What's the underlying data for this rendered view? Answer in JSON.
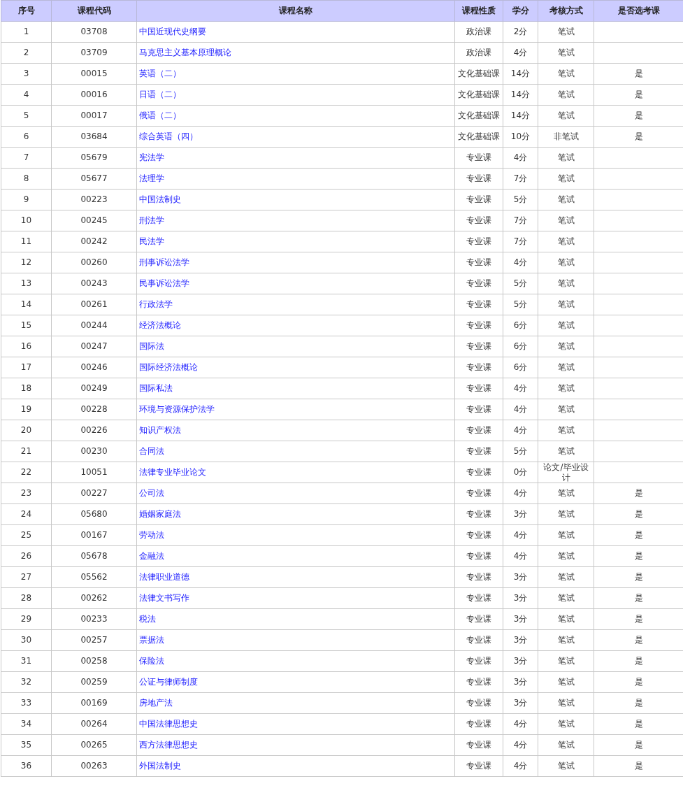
{
  "table": {
    "columns": [
      "序号",
      "课程代码",
      "课程名称",
      "课程性质",
      "学分",
      "考核方式",
      "是否选考课"
    ],
    "rows": [
      {
        "no": "1",
        "code": "03708",
        "name": "中国近现代史纲要",
        "nature": "政治课",
        "credits": "2分",
        "exam": "笔试"
      },
      {
        "no": "2",
        "code": "03709",
        "name": "马克思主义基本原理概论",
        "nature": "政治课",
        "credits": "4分",
        "exam": "笔试"
      },
      {
        "no": "3",
        "code": "00015",
        "name": "英语（二）",
        "nature": "文化基础课",
        "credits": "14分",
        "exam": "笔试",
        "elective": "是"
      },
      {
        "no": "4",
        "code": "00016",
        "name": "日语（二）",
        "nature": "文化基础课",
        "credits": "14分",
        "exam": "笔试",
        "elective": "是"
      },
      {
        "no": "5",
        "code": "00017",
        "name": "俄语（二）",
        "nature": "文化基础课",
        "credits": "14分",
        "exam": "笔试",
        "elective": "是"
      },
      {
        "no": "6",
        "code": "03684",
        "name": "综合英语（四）",
        "nature": "文化基础课",
        "credits": "10分",
        "exam": "非笔试",
        "elective": "是"
      },
      {
        "no": "7",
        "code": "05679",
        "name": "宪法学",
        "nature": "专业课",
        "credits": "4分",
        "exam": "笔试"
      },
      {
        "no": "8",
        "code": "05677",
        "name": "法理学",
        "nature": "专业课",
        "credits": "7分",
        "exam": "笔试"
      },
      {
        "no": "9",
        "code": "00223",
        "name": "中国法制史",
        "nature": "专业课",
        "credits": "5分",
        "exam": "笔试"
      },
      {
        "no": "10",
        "code": "00245",
        "name": "刑法学",
        "nature": "专业课",
        "credits": "7分",
        "exam": "笔试"
      },
      {
        "no": "11",
        "code": "00242",
        "name": "民法学",
        "nature": "专业课",
        "credits": "7分",
        "exam": "笔试"
      },
      {
        "no": "12",
        "code": "00260",
        "name": "刑事诉讼法学",
        "nature": "专业课",
        "credits": "4分",
        "exam": "笔试"
      },
      {
        "no": "13",
        "code": "00243",
        "name": "民事诉讼法学",
        "nature": "专业课",
        "credits": "5分",
        "exam": "笔试"
      },
      {
        "no": "14",
        "code": "00261",
        "name": "行政法学",
        "nature": "专业课",
        "credits": "5分",
        "exam": "笔试"
      },
      {
        "no": "15",
        "code": "00244",
        "name": "经济法概论",
        "nature": "专业课",
        "credits": "6分",
        "exam": "笔试"
      },
      {
        "no": "16",
        "code": "00247",
        "name": "国际法",
        "nature": "专业课",
        "credits": "6分",
        "exam": "笔试"
      },
      {
        "no": "17",
        "code": "00246",
        "name": "国际经济法概论",
        "nature": "专业课",
        "credits": "6分",
        "exam": "笔试"
      },
      {
        "no": "18",
        "code": "00249",
        "name": "国际私法",
        "nature": "专业课",
        "credits": "4分",
        "exam": "笔试"
      },
      {
        "no": "19",
        "code": "00228",
        "name": "环境与资源保护法学",
        "nature": "专业课",
        "credits": "4分",
        "exam": "笔试"
      },
      {
        "no": "20",
        "code": "00226",
        "name": "知识产权法",
        "nature": "专业课",
        "credits": "4分",
        "exam": "笔试"
      },
      {
        "no": "21",
        "code": "00230",
        "name": "合同法",
        "nature": "专业课",
        "credits": "5分",
        "exam": "笔试"
      },
      {
        "no": "22",
        "code": "10051",
        "name": "法律专业毕业论文",
        "nature": "专业课",
        "credits": "0分",
        "exam": "论文/毕业设计"
      },
      {
        "no": "23",
        "code": "00227",
        "name": "公司法",
        "nature": "专业课",
        "credits": "4分",
        "exam": "笔试",
        "elective": "是"
      },
      {
        "no": "24",
        "code": "05680",
        "name": "婚姻家庭法",
        "nature": "专业课",
        "credits": "3分",
        "exam": "笔试",
        "elective": "是"
      },
      {
        "no": "25",
        "code": "00167",
        "name": "劳动法",
        "nature": "专业课",
        "credits": "4分",
        "exam": "笔试",
        "elective": "是"
      },
      {
        "no": "26",
        "code": "05678",
        "name": "金融法",
        "nature": "专业课",
        "credits": "4分",
        "exam": "笔试",
        "elective": "是"
      },
      {
        "no": "27",
        "code": "05562",
        "name": "法律职业道德",
        "nature": "专业课",
        "credits": "3分",
        "exam": "笔试",
        "elective": "是"
      },
      {
        "no": "28",
        "code": "00262",
        "name": "法律文书写作",
        "nature": "专业课",
        "credits": "3分",
        "exam": "笔试",
        "elective": "是"
      },
      {
        "no": "29",
        "code": "00233",
        "name": "税法",
        "nature": "专业课",
        "credits": "3分",
        "exam": "笔试",
        "elective": "是"
      },
      {
        "no": "30",
        "code": "00257",
        "name": "票据法",
        "nature": "专业课",
        "credits": "3分",
        "exam": "笔试",
        "elective": "是"
      },
      {
        "no": "31",
        "code": "00258",
        "name": "保险法",
        "nature": "专业课",
        "credits": "3分",
        "exam": "笔试",
        "elective": "是"
      },
      {
        "no": "32",
        "code": "00259",
        "name": "公证与律师制度",
        "nature": "专业课",
        "credits": "3分",
        "exam": "笔试",
        "elective": "是"
      },
      {
        "no": "33",
        "code": "00169",
        "name": "房地产法",
        "nature": "专业课",
        "credits": "3分",
        "exam": "笔试",
        "elective": "是"
      },
      {
        "no": "34",
        "code": "00264",
        "name": "中国法律思想史",
        "nature": "专业课",
        "credits": "4分",
        "exam": "笔试",
        "elective": "是"
      },
      {
        "no": "35",
        "code": "00265",
        "name": "西方法律思想史",
        "nature": "专业课",
        "credits": "4分",
        "exam": "笔试",
        "elective": "是"
      },
      {
        "no": "36",
        "code": "00263",
        "name": "外国法制史",
        "nature": "专业课",
        "credits": "4分",
        "exam": "笔试",
        "elective": "是"
      }
    ]
  }
}
